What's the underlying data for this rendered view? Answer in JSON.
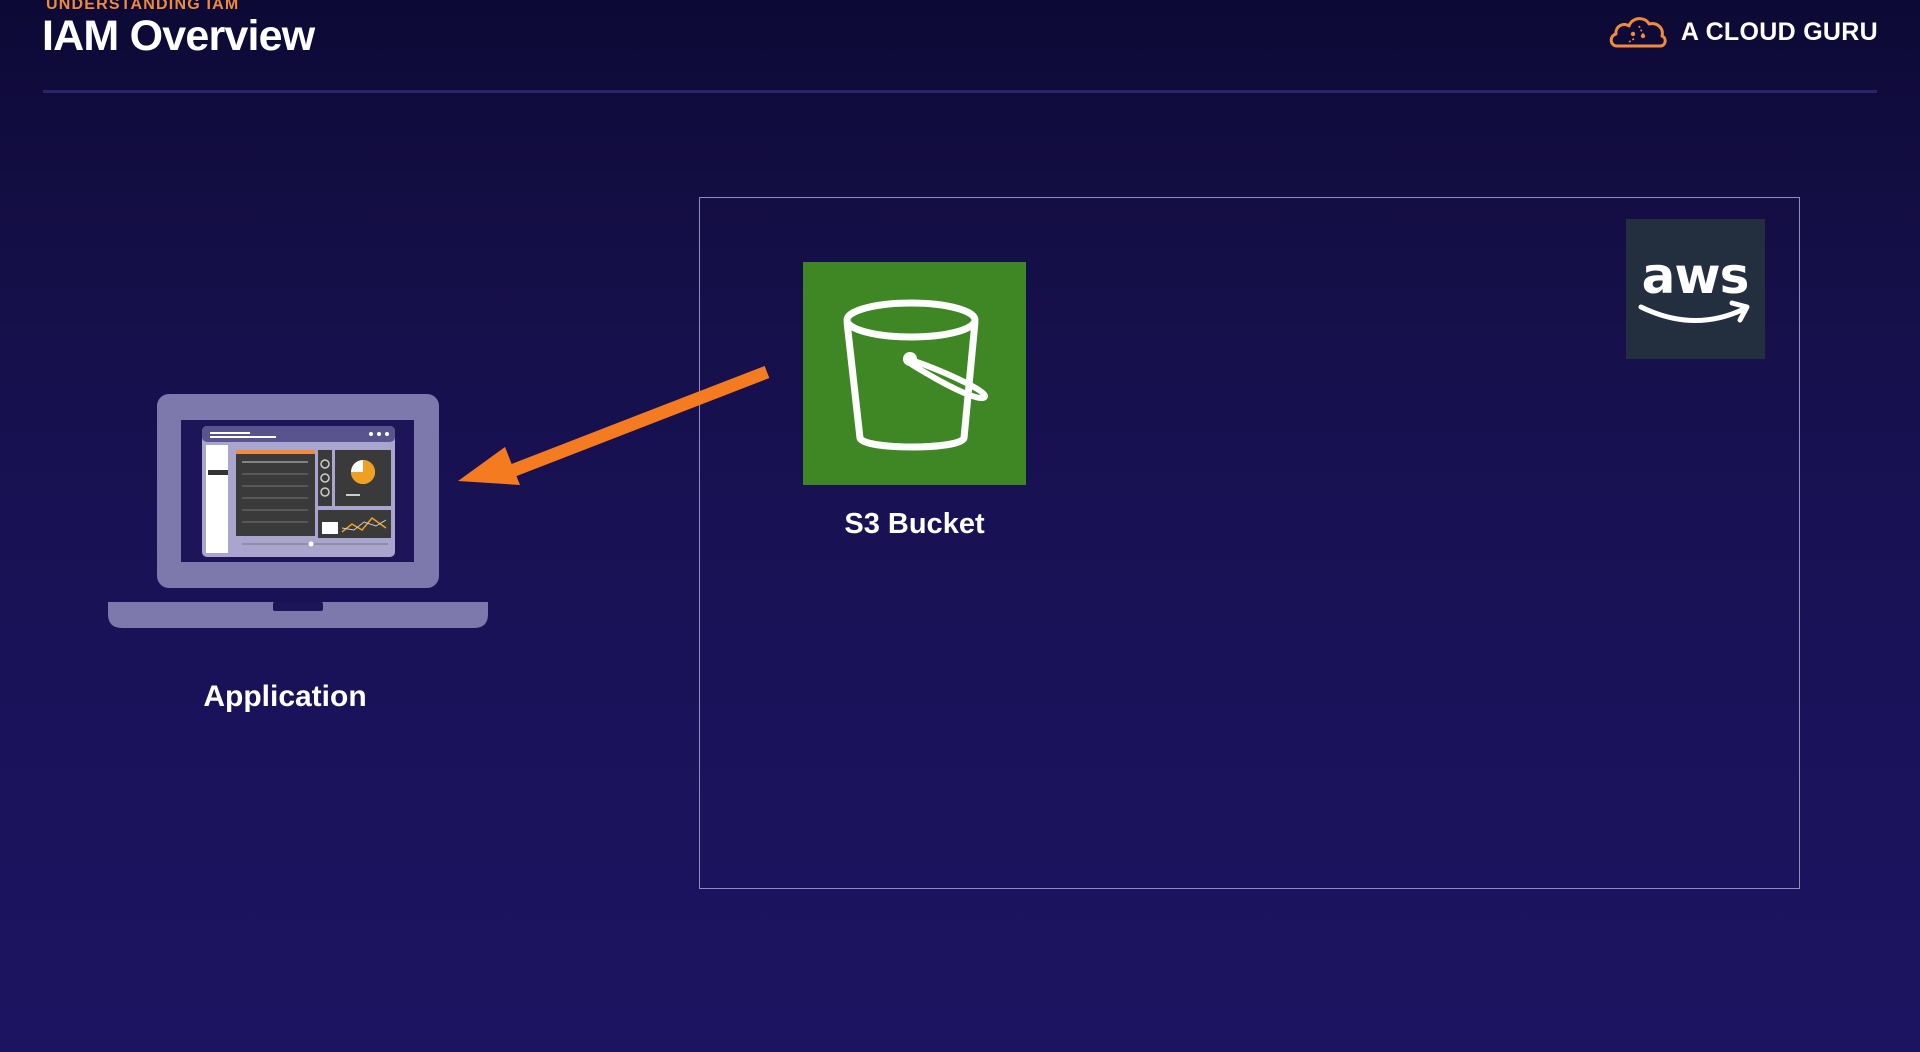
{
  "header": {
    "subtitle": "UNDERSTANDING IAM",
    "title": "IAM Overview",
    "brand": "A CLOUD GURU"
  },
  "diagram": {
    "s3_label": "S3 Bucket",
    "app_label": "Application",
    "aws_logo_text": "aws"
  },
  "colors": {
    "accent_orange": "#f08a3c",
    "arrow": "#f47b20",
    "s3_green": "#3f8624",
    "aws_dark": "#232f3e",
    "background": "#1a1258"
  },
  "icons": [
    "cloud-logo-icon",
    "aws-logo-icon",
    "s3-bucket-icon",
    "laptop-icon",
    "arrow-icon"
  ]
}
